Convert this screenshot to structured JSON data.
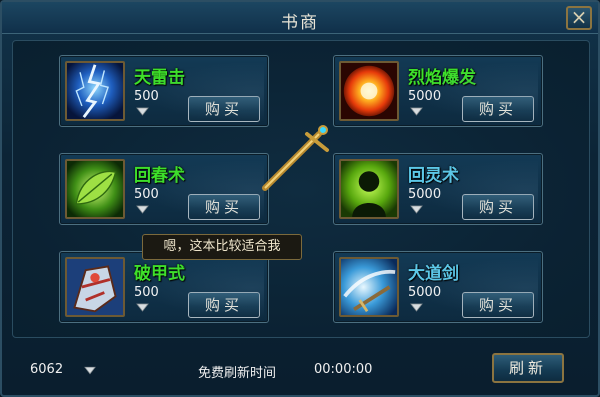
{
  "window": {
    "title": "书商"
  },
  "skills": [
    {
      "name": "天雷击",
      "price": "500",
      "buy_label": "购买",
      "icon": "lightning-icon",
      "name_color": "green"
    },
    {
      "name": "烈焰爆发",
      "price": "5000",
      "buy_label": "购买",
      "icon": "flame-burst-icon",
      "name_color": "green"
    },
    {
      "name": "回春术",
      "price": "500",
      "buy_label": "购买",
      "icon": "leaf-icon",
      "name_color": "green"
    },
    {
      "name": "回灵术",
      "price": "5000",
      "buy_label": "购买",
      "icon": "spirit-silhouette-icon",
      "name_color": "cyan"
    },
    {
      "name": "破甲式",
      "price": "500",
      "buy_label": "购买",
      "icon": "armor-break-icon",
      "name_color": "green"
    },
    {
      "name": "大道剑",
      "price": "5000",
      "buy_label": "购买",
      "icon": "sword-slash-icon",
      "name_color": "cyan"
    }
  ],
  "hint_bubble": {
    "text": "嗯，这本比较适合我"
  },
  "footer": {
    "balance": "6062",
    "free_refresh_label": "免费刷新时间",
    "timer": "00:00:00",
    "refresh_label": "刷新"
  },
  "colors": {
    "green_name": "#3ee02a",
    "cyan_name": "#5cc8e8",
    "gold_border": "#8b7440"
  }
}
